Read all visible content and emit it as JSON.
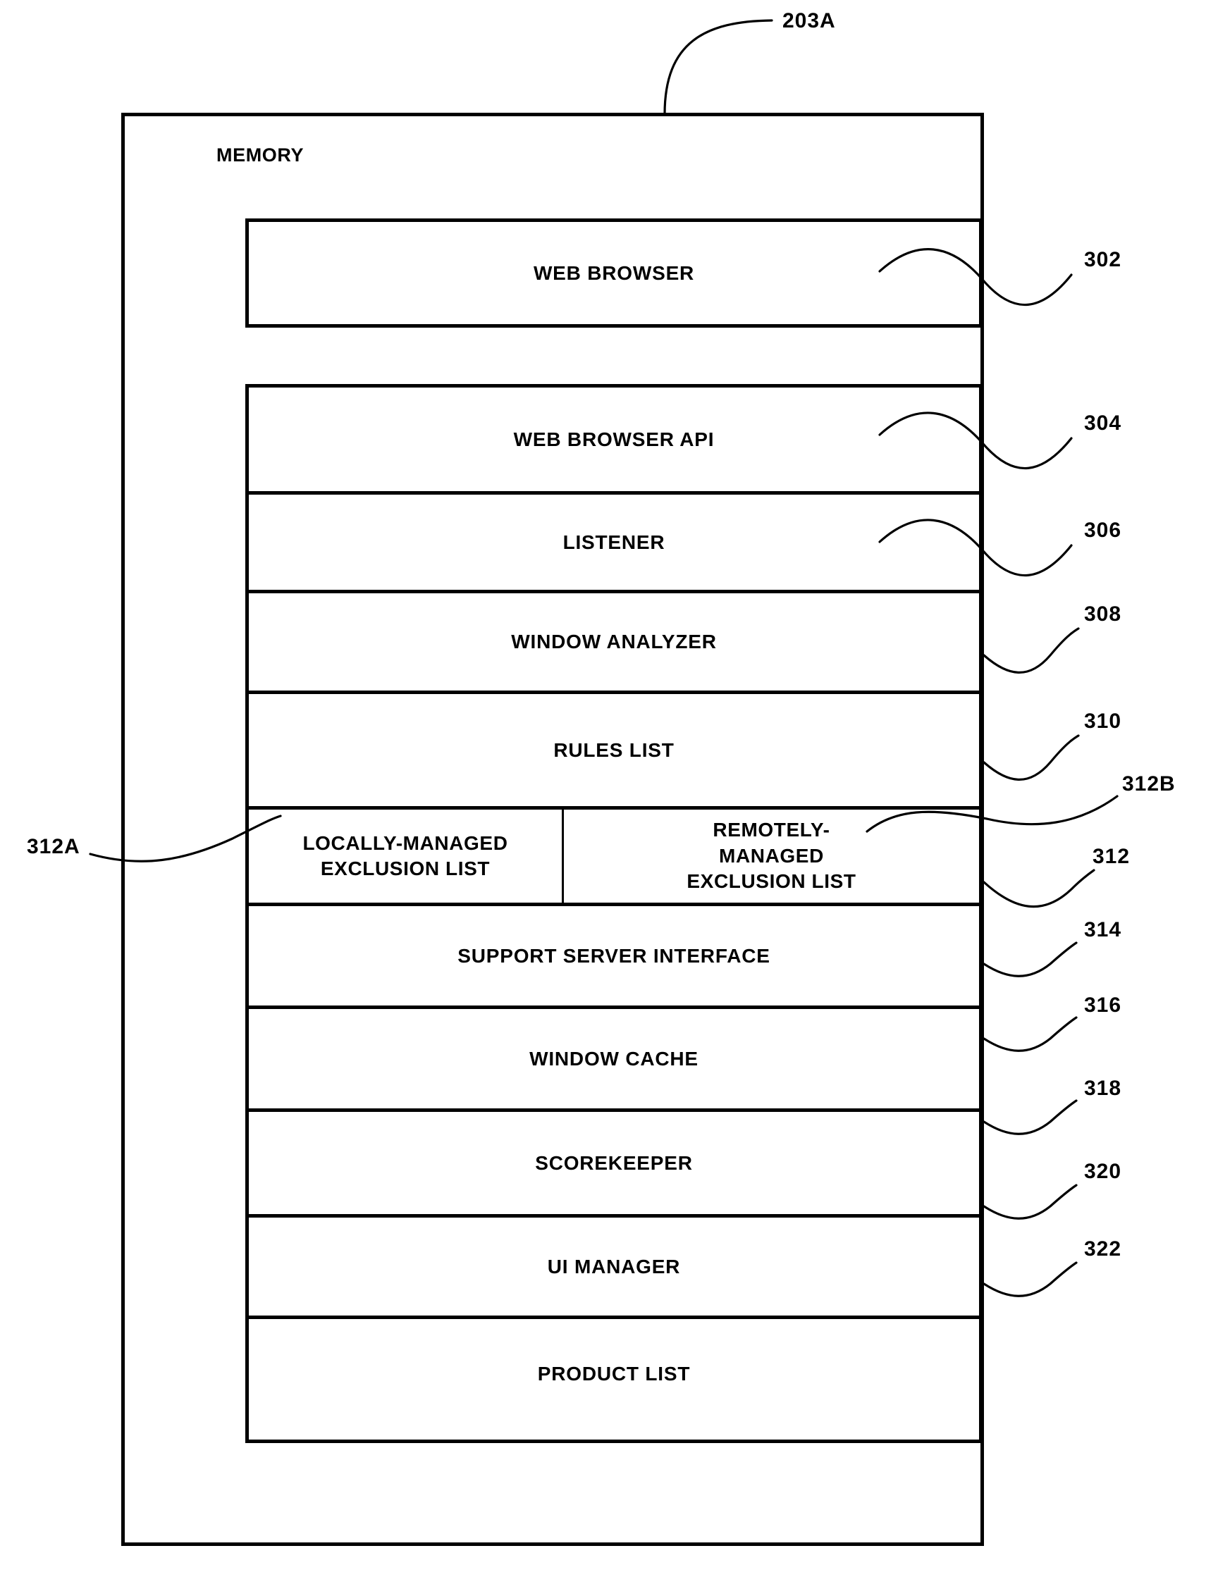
{
  "figure": {
    "top_reference": "203A",
    "memory_label": "MEMORY"
  },
  "web_browser": {
    "label": "WEB BROWSER",
    "reference": "302"
  },
  "stack": {
    "rows": [
      {
        "label": "WEB BROWSER API",
        "reference": "304"
      },
      {
        "label": "LISTENER",
        "reference": "306"
      },
      {
        "label": "WINDOW ANALYZER",
        "reference": "308"
      },
      {
        "label": "RULES LIST",
        "reference": "310"
      },
      {
        "label": "SUPPORT SERVER INTERFACE",
        "reference": "314"
      },
      {
        "label": "WINDOW CACHE",
        "reference": "316"
      },
      {
        "label": "SCOREKEEPER",
        "reference": "318"
      },
      {
        "label": "UI MANAGER",
        "reference": "320"
      },
      {
        "label": "PRODUCT LIST",
        "reference": "322"
      }
    ],
    "exclusion_row": {
      "reference": "312",
      "left": {
        "line1": "LOCALLY-MANAGED",
        "line2": "EXCLUSION LIST",
        "reference": "312A"
      },
      "right": {
        "line1": "REMOTELY-",
        "line2": "MANAGED",
        "line3": "EXCLUSION LIST",
        "reference": "312B"
      }
    }
  },
  "colors": {
    "ink": "#000000",
    "paper": "#ffffff"
  }
}
